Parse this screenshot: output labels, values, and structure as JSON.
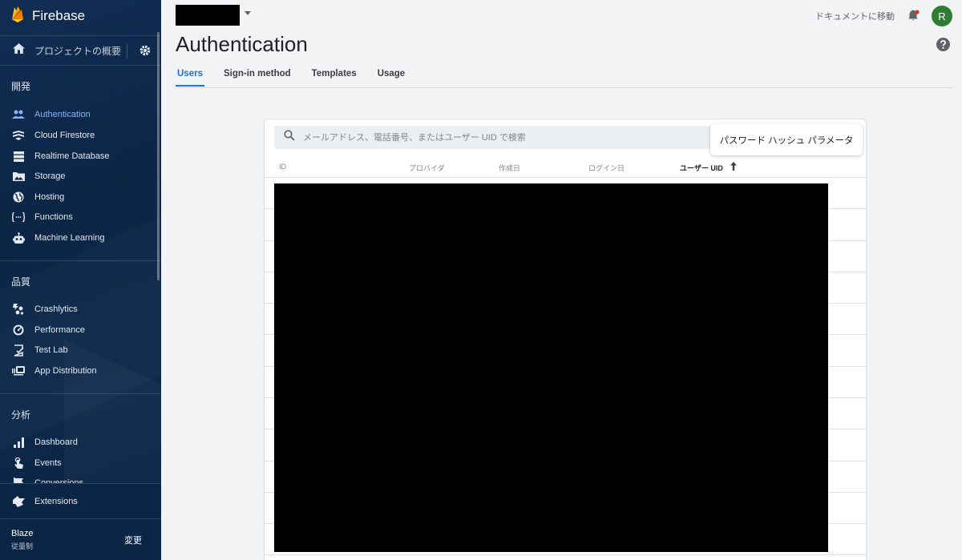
{
  "brand": {
    "name": "Firebase"
  },
  "overview": {
    "label": "プロジェクトの概要"
  },
  "sections": {
    "develop": "開発",
    "quality": "品質",
    "analytics": "分析"
  },
  "nav": {
    "develop": [
      {
        "label": "Authentication",
        "icon": "people-icon",
        "active": true
      },
      {
        "label": "Cloud Firestore",
        "icon": "firestore-icon"
      },
      {
        "label": "Realtime Database",
        "icon": "database-icon"
      },
      {
        "label": "Storage",
        "icon": "image-folder-icon"
      },
      {
        "label": "Hosting",
        "icon": "globe-icon"
      },
      {
        "label": "Functions",
        "icon": "functions-icon"
      },
      {
        "label": "Machine Learning",
        "icon": "robot-icon"
      }
    ],
    "quality": [
      {
        "label": "Crashlytics",
        "icon": "crashlytics-icon"
      },
      {
        "label": "Performance",
        "icon": "speedometer-icon"
      },
      {
        "label": "Test Lab",
        "icon": "checklist-icon"
      },
      {
        "label": "App Distribution",
        "icon": "app-distribution-icon"
      }
    ],
    "analytics": [
      {
        "label": "Dashboard",
        "icon": "bar-chart-icon"
      },
      {
        "label": "Events",
        "icon": "touch-icon"
      },
      {
        "label": "Conversions",
        "icon": "flag-icon"
      }
    ],
    "extensions": {
      "label": "Extensions",
      "icon": "extensions-icon"
    }
  },
  "plan": {
    "name": "Blaze",
    "type": "従量制",
    "change": "変更"
  },
  "header": {
    "docs_link": "ドキュメントに移動",
    "avatar_letter": "R"
  },
  "page": {
    "title": "Authentication"
  },
  "tabs": [
    "Users",
    "Sign-in method",
    "Templates",
    "Usage"
  ],
  "users": {
    "search_placeholder": "メールアドレス、電話番号、またはユーザー UID で検索",
    "password_hash_button": "パスワード ハッシュ パラメータ",
    "columns": [
      "ID",
      "プロバイダ",
      "作成日",
      "ログイン日",
      "ユーザー UID"
    ],
    "sorted_column": "ユーザー UID",
    "sort_direction": "ascending"
  },
  "colors": {
    "sidebar": "#0b2545",
    "accent": "#1a73e8",
    "active_nav": "#8ab4f8",
    "avatar": "#2e7d32"
  }
}
